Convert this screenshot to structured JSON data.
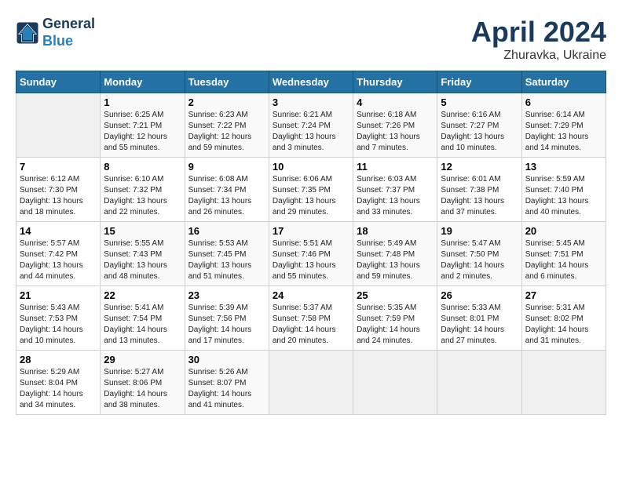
{
  "header": {
    "logo_line1": "General",
    "logo_line2": "Blue",
    "month": "April 2024",
    "location": "Zhuravka, Ukraine"
  },
  "weekdays": [
    "Sunday",
    "Monday",
    "Tuesday",
    "Wednesday",
    "Thursday",
    "Friday",
    "Saturday"
  ],
  "weeks": [
    [
      {
        "day": "",
        "info": ""
      },
      {
        "day": "1",
        "info": "Sunrise: 6:25 AM\nSunset: 7:21 PM\nDaylight: 12 hours\nand 55 minutes."
      },
      {
        "day": "2",
        "info": "Sunrise: 6:23 AM\nSunset: 7:22 PM\nDaylight: 12 hours\nand 59 minutes."
      },
      {
        "day": "3",
        "info": "Sunrise: 6:21 AM\nSunset: 7:24 PM\nDaylight: 13 hours\nand 3 minutes."
      },
      {
        "day": "4",
        "info": "Sunrise: 6:18 AM\nSunset: 7:26 PM\nDaylight: 13 hours\nand 7 minutes."
      },
      {
        "day": "5",
        "info": "Sunrise: 6:16 AM\nSunset: 7:27 PM\nDaylight: 13 hours\nand 10 minutes."
      },
      {
        "day": "6",
        "info": "Sunrise: 6:14 AM\nSunset: 7:29 PM\nDaylight: 13 hours\nand 14 minutes."
      }
    ],
    [
      {
        "day": "7",
        "info": "Sunrise: 6:12 AM\nSunset: 7:30 PM\nDaylight: 13 hours\nand 18 minutes."
      },
      {
        "day": "8",
        "info": "Sunrise: 6:10 AM\nSunset: 7:32 PM\nDaylight: 13 hours\nand 22 minutes."
      },
      {
        "day": "9",
        "info": "Sunrise: 6:08 AM\nSunset: 7:34 PM\nDaylight: 13 hours\nand 26 minutes."
      },
      {
        "day": "10",
        "info": "Sunrise: 6:06 AM\nSunset: 7:35 PM\nDaylight: 13 hours\nand 29 minutes."
      },
      {
        "day": "11",
        "info": "Sunrise: 6:03 AM\nSunset: 7:37 PM\nDaylight: 13 hours\nand 33 minutes."
      },
      {
        "day": "12",
        "info": "Sunrise: 6:01 AM\nSunset: 7:38 PM\nDaylight: 13 hours\nand 37 minutes."
      },
      {
        "day": "13",
        "info": "Sunrise: 5:59 AM\nSunset: 7:40 PM\nDaylight: 13 hours\nand 40 minutes."
      }
    ],
    [
      {
        "day": "14",
        "info": "Sunrise: 5:57 AM\nSunset: 7:42 PM\nDaylight: 13 hours\nand 44 minutes."
      },
      {
        "day": "15",
        "info": "Sunrise: 5:55 AM\nSunset: 7:43 PM\nDaylight: 13 hours\nand 48 minutes."
      },
      {
        "day": "16",
        "info": "Sunrise: 5:53 AM\nSunset: 7:45 PM\nDaylight: 13 hours\nand 51 minutes."
      },
      {
        "day": "17",
        "info": "Sunrise: 5:51 AM\nSunset: 7:46 PM\nDaylight: 13 hours\nand 55 minutes."
      },
      {
        "day": "18",
        "info": "Sunrise: 5:49 AM\nSunset: 7:48 PM\nDaylight: 13 hours\nand 59 minutes."
      },
      {
        "day": "19",
        "info": "Sunrise: 5:47 AM\nSunset: 7:50 PM\nDaylight: 14 hours\nand 2 minutes."
      },
      {
        "day": "20",
        "info": "Sunrise: 5:45 AM\nSunset: 7:51 PM\nDaylight: 14 hours\nand 6 minutes."
      }
    ],
    [
      {
        "day": "21",
        "info": "Sunrise: 5:43 AM\nSunset: 7:53 PM\nDaylight: 14 hours\nand 10 minutes."
      },
      {
        "day": "22",
        "info": "Sunrise: 5:41 AM\nSunset: 7:54 PM\nDaylight: 14 hours\nand 13 minutes."
      },
      {
        "day": "23",
        "info": "Sunrise: 5:39 AM\nSunset: 7:56 PM\nDaylight: 14 hours\nand 17 minutes."
      },
      {
        "day": "24",
        "info": "Sunrise: 5:37 AM\nSunset: 7:58 PM\nDaylight: 14 hours\nand 20 minutes."
      },
      {
        "day": "25",
        "info": "Sunrise: 5:35 AM\nSunset: 7:59 PM\nDaylight: 14 hours\nand 24 minutes."
      },
      {
        "day": "26",
        "info": "Sunrise: 5:33 AM\nSunset: 8:01 PM\nDaylight: 14 hours\nand 27 minutes."
      },
      {
        "day": "27",
        "info": "Sunrise: 5:31 AM\nSunset: 8:02 PM\nDaylight: 14 hours\nand 31 minutes."
      }
    ],
    [
      {
        "day": "28",
        "info": "Sunrise: 5:29 AM\nSunset: 8:04 PM\nDaylight: 14 hours\nand 34 minutes."
      },
      {
        "day": "29",
        "info": "Sunrise: 5:27 AM\nSunset: 8:06 PM\nDaylight: 14 hours\nand 38 minutes."
      },
      {
        "day": "30",
        "info": "Sunrise: 5:26 AM\nSunset: 8:07 PM\nDaylight: 14 hours\nand 41 minutes."
      },
      {
        "day": "",
        "info": ""
      },
      {
        "day": "",
        "info": ""
      },
      {
        "day": "",
        "info": ""
      },
      {
        "day": "",
        "info": ""
      }
    ]
  ]
}
